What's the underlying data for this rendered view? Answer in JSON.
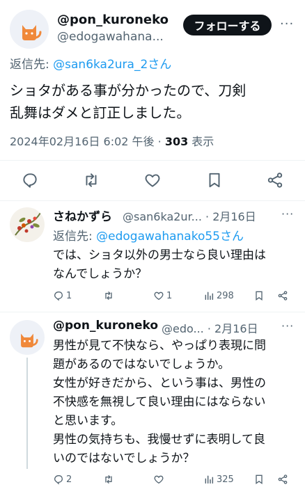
{
  "main_tweet": {
    "name": "@pon_kuroneko",
    "handle": "@edogawahana...",
    "follow_label": "フォローする",
    "more": "···",
    "reply_prefix": "返信先: ",
    "reply_to": "@san6ka2ura_2さん",
    "text_line1": "ショタがある事が分かったので、刀剣",
    "text_line2": "乱舞はダメと訂正しました。",
    "date": "2024年02月16日 6:02 午後 · ",
    "views": "303",
    "views_label": " 表示"
  },
  "reply1": {
    "name": "さねかずら",
    "handle_date": "@san6ka2ur... · 2月16日",
    "more": "···",
    "reply_prefix": "返信先: ",
    "reply_to": "@edogawahanako55さん",
    "text_line1": "では、ショタ以外の男士なら良い理由は",
    "text_line2": "なんでしょうか？",
    "replies": "1",
    "likes": "1",
    "views": "298"
  },
  "reply2": {
    "name": "@pon_kuroneko",
    "handle_date": "@edo... · 2月16日",
    "more": "···",
    "text_line1": "男性が見て不快なら、やっぱり表現に問",
    "text_line2": "題があるのではないでしょうか。",
    "text_line3": "女性が好きだから、という事は、男性の",
    "text_line4": "不快感を無視して良い理由にはならない",
    "text_line5": "と思います。",
    "text_line6": "男性の気持ちも、我慢せずに表明して良",
    "text_line7": "いのではないでしょうか？",
    "replies": "2",
    "views": "325"
  },
  "colors": {
    "accent": "#1d9bf0",
    "secondary_text": "#536471",
    "cat_orange": "#f0893b"
  }
}
